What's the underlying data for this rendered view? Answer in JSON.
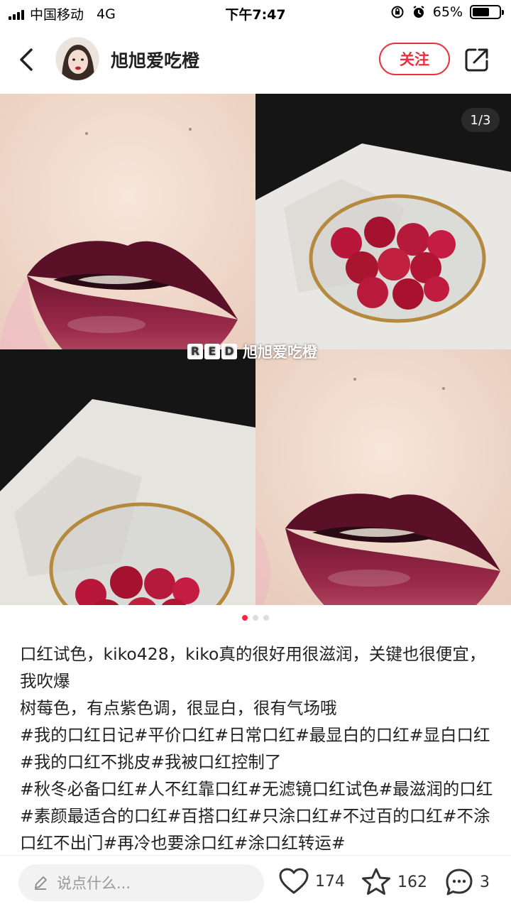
{
  "status_bar": {
    "carrier": "中国移动",
    "network": "4G",
    "time": "下午7:47",
    "battery": "65%",
    "battery_level": 0.65
  },
  "header": {
    "username": "旭旭爱吃橙",
    "follow_label": "关注"
  },
  "gallery": {
    "page_indicator": "1/3",
    "watermark_logo": [
      "R",
      "E",
      "D"
    ],
    "watermark_text": "旭旭爱吃橙",
    "total_pages": 3,
    "current_page": 1
  },
  "post": {
    "lines": [
      "口红试色，kiko428，kiko真的很好用很滋润，关键也很便宜，我吹爆",
      "树莓色，有点紫色调，很显白，很有气场哦",
      "#我的口红日记#平价口红#日常口红#最显白的口红#显白口红#我的口红不挑皮#我被口红控制了",
      "#秋冬必备口红#人不红靠口红#无滤镜口红试色#最滋润的口红#素颜最适合的口红#百搭口红#只涂口红#不过百的口红#不涂口红不出门#再冷也要涂口红#涂口红转运#"
    ]
  },
  "bottom_bar": {
    "comment_placeholder": "说点什么...",
    "likes": "174",
    "favorites": "162",
    "comments": "3"
  },
  "colors": {
    "accent": "#e8303e",
    "active_dot": "#ff2442",
    "lip": "#8a1f3c",
    "raspberry": "#b8163a"
  }
}
